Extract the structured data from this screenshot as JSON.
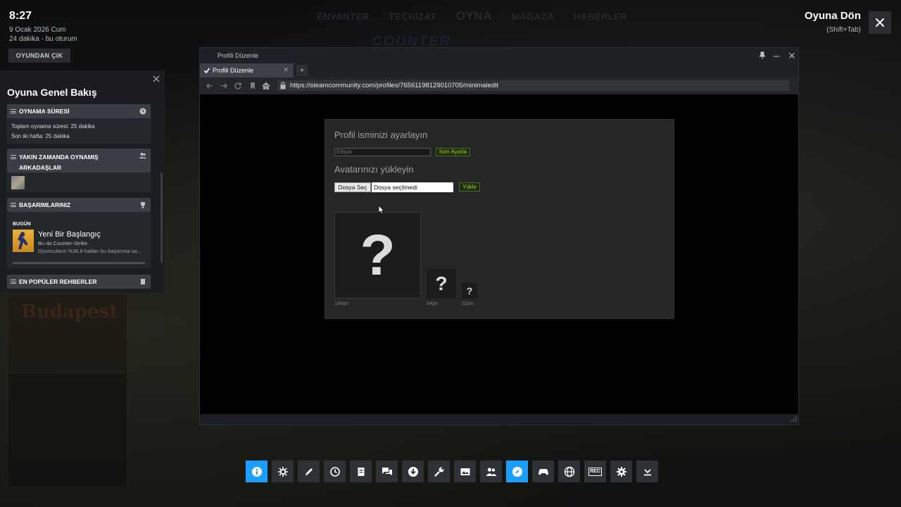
{
  "clock": {
    "time": "8:27",
    "date": "9 Ocak 2026 Cum",
    "session": "24 dakika - bu oturum"
  },
  "quit_game_label": "OYUNDAN ÇIK",
  "return": {
    "title": "Oyuna Dön",
    "hint": "(Shift+Tab)"
  },
  "background": {
    "nav_items": [
      "ENVANTER",
      "TEÇHİZAT",
      "OYNA",
      "MAĞAZA",
      "HABERLER"
    ],
    "logo_text": "COUNTER",
    "card_title": "Budapest"
  },
  "overview": {
    "title": "Oyuna Genel Bakış",
    "playtime": {
      "heading": "OYNAMA SÜRESİ",
      "total": "Toplam oynama süresi: 25 dakika",
      "last_two_weeks": "Son iki hafta: 25 dakika"
    },
    "friends": {
      "heading": "YAKIN ZAMANDA OYNAMIŞ ARKADAŞLAR"
    },
    "achievements": {
      "heading": "BAŞARIMLARINIZ",
      "today_label": "BUGÜN",
      "title": "Yeni Bir Başlangıç",
      "description": "Bu da Counter-Strike.",
      "percent": "Oyuncuların %36.8 kadarı bu başarıma sa..."
    },
    "guides": {
      "heading": "EN POPÜLER REHBERLER"
    }
  },
  "browser": {
    "window_title": "Profili Düzenle",
    "tab_label": "Profili Düzenle",
    "new_tab": "+",
    "url": "https://steamcommunity.com/profiles/76561198129010705/minimaledit"
  },
  "edit": {
    "name_heading": "Profil isminizi ayarlayın",
    "name_value": "Elisya",
    "set_name_label": "İsim Ayarla",
    "avatar_heading": "Avatarınızı yükleyin",
    "choose_file_label": "Dosya Seç",
    "no_file_label": "Dosya seçilmedi",
    "upload_label": "Yükle",
    "avatar_placeholder": "?",
    "size_labels": [
      "184px",
      "64px",
      "32px"
    ]
  },
  "toolbar": {
    "rec_label": "REC",
    "active_index": [
      0,
      10
    ],
    "icons": [
      "info-icon",
      "achievements-icon",
      "notes-icon",
      "recent-icon",
      "guides-icon",
      "chat-icon",
      "downloads-icon",
      "tools-icon",
      "screenshots-icon",
      "friends-icon",
      "browser-icon",
      "controller-icon",
      "web-icon",
      "recording-icon",
      "settings-icon",
      "collapse-icon"
    ]
  },
  "colors": {
    "accent": "#1a9fff",
    "steam_green": "#a4d007",
    "panel": "#1b1d20"
  }
}
